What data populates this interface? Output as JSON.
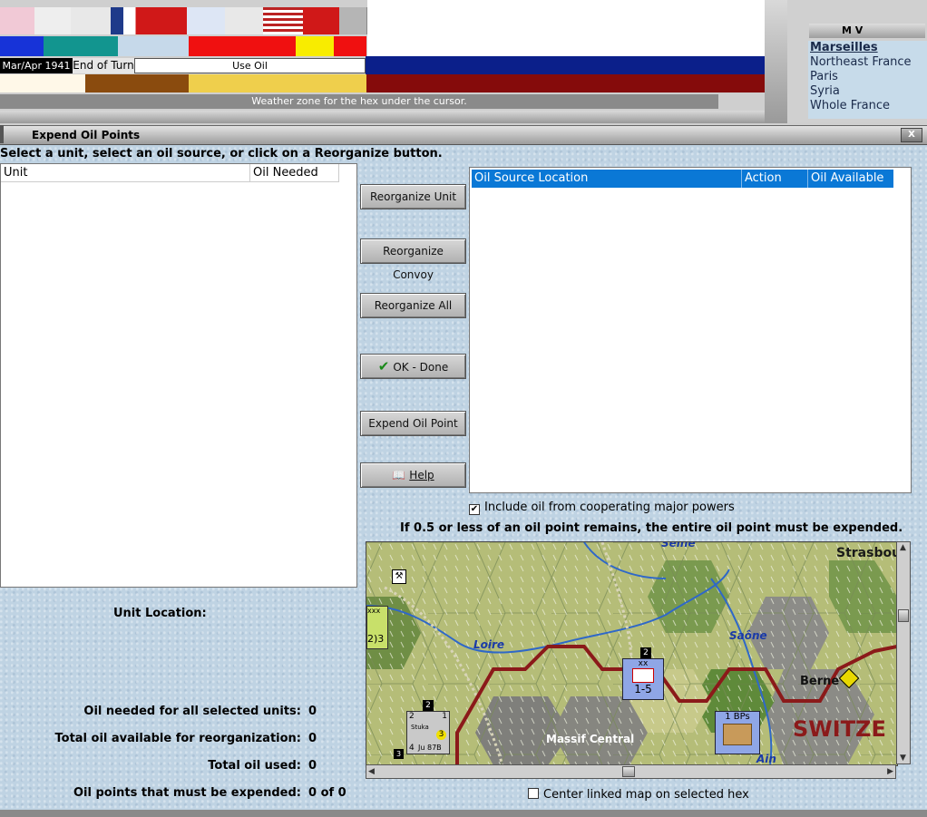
{
  "top": {
    "turn": "Mar/Apr 1941",
    "end_of_turn": "End of Turn",
    "phase": "Use Oil",
    "weather_status": "Weather zone for the hex under the cursor."
  },
  "map_views": {
    "title": "M V",
    "items": [
      "Marseilles",
      "Northeast France",
      "Paris",
      "Syria",
      "Whole France"
    ]
  },
  "dialog": {
    "title": "Expend Oil Points",
    "close_label": "X",
    "instruction": "Select a unit, select an oil source, or click on a Reorganize button.",
    "unit_table": {
      "columns": [
        "Unit",
        "Oil Needed"
      ]
    },
    "buttons": {
      "reorganize_unit": "Reorganize Unit",
      "reorganize_convoy": "Reorganize Convoy",
      "reorganize_all": "Reorganize All",
      "ok_done": "OK - Done",
      "expend_oil_point": "Expend Oil Point",
      "help": "Help"
    },
    "oil_table": {
      "columns": [
        "Oil Source Location",
        "Action",
        "Oil Available"
      ]
    },
    "include_coop": {
      "label": "Include oil from cooperating major powers",
      "checked": true
    },
    "rule_text": "If 0.5 or less of an oil point remains, the entire oil point must be expended.",
    "unit_location_label": "Unit Location:",
    "stats": [
      {
        "label": "Oil needed for all selected units:",
        "value": "0"
      },
      {
        "label": "Total oil available for reorganization:",
        "value": "0"
      },
      {
        "label": "Total oil used:",
        "value": "0"
      },
      {
        "label": "Oil points that must be expended:",
        "value": "0 of 0"
      }
    ],
    "center_linked": {
      "label": "Center linked map on selected hex",
      "checked": false
    }
  },
  "map": {
    "labels": {
      "seine": "Seine",
      "strasbourg": "Strasbou",
      "loire": "Loire",
      "saone": "Saône",
      "berne": "Berne",
      "massif": "Massif Central",
      "switzerland": "SWITZE",
      "ain": "Ain"
    },
    "counters": {
      "french_corps": {
        "size": "xx",
        "top_number": "2",
        "strength": "1-5"
      },
      "bps": {
        "label": "1 BPs"
      },
      "stuka": {
        "label": "Stuka",
        "model": "Ju 87B",
        "top_left": "2",
        "top_right": "1",
        "bottom_left": "4",
        "range": "3",
        "stack": "2"
      },
      "left_unit": {
        "text": "2)3",
        "size": "xxx"
      },
      "corner_number": "3"
    }
  },
  "colors": {
    "selected_header": "#0a78d6",
    "switzerland_border": "#8b1a1a",
    "weather_status_bg": "#8a8a8a"
  }
}
